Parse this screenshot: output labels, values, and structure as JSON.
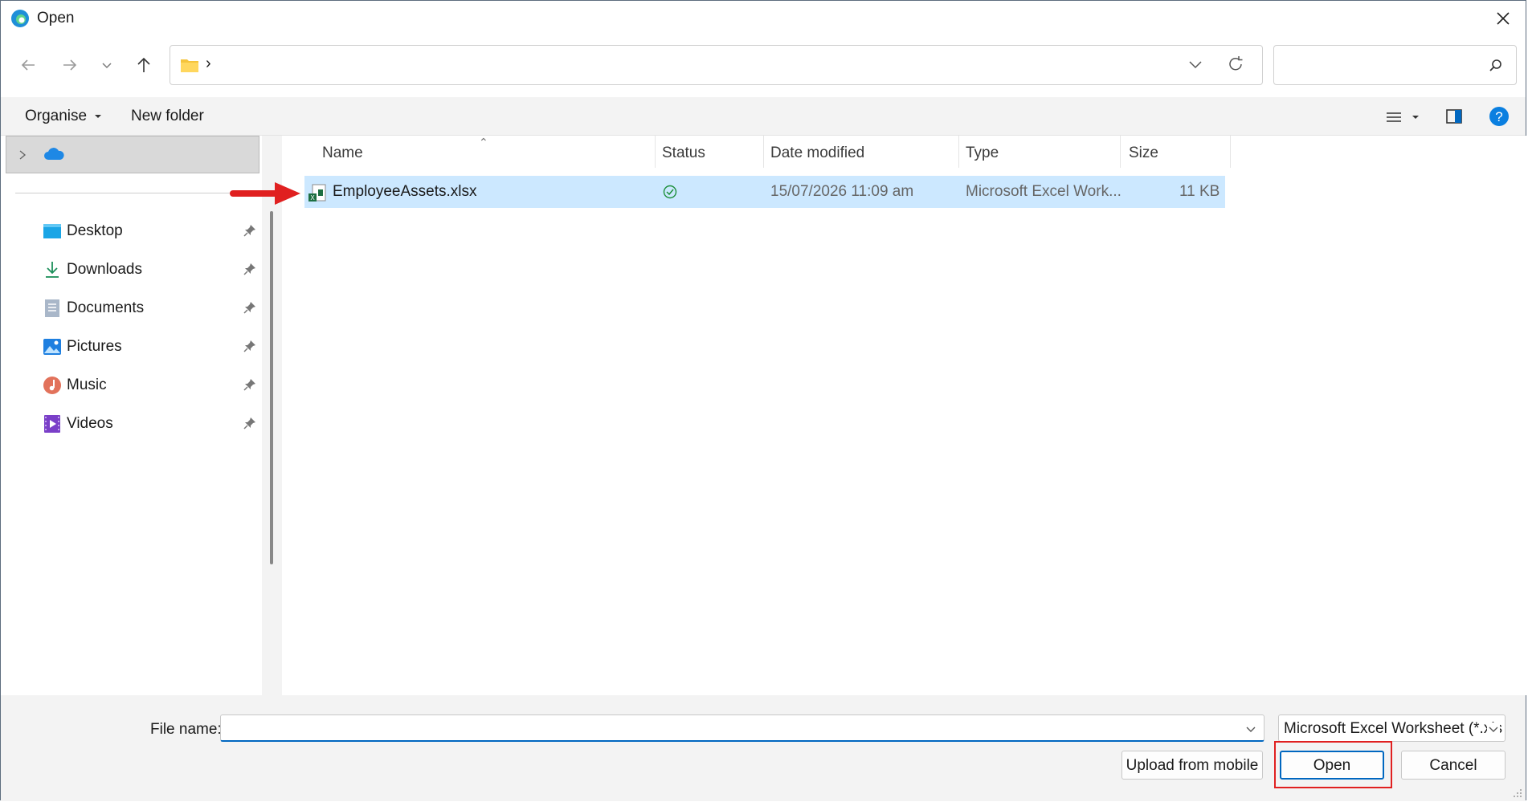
{
  "window": {
    "title": "Open"
  },
  "nav": {
    "address_separator": "›"
  },
  "toolbar": {
    "organise_label": "Organise",
    "new_folder_label": "New folder"
  },
  "sidebar": {
    "items": [
      {
        "label": "Desktop",
        "icon": "desktop-icon"
      },
      {
        "label": "Downloads",
        "icon": "downloads-icon"
      },
      {
        "label": "Documents",
        "icon": "documents-icon"
      },
      {
        "label": "Pictures",
        "icon": "pictures-icon"
      },
      {
        "label": "Music",
        "icon": "music-icon"
      },
      {
        "label": "Videos",
        "icon": "videos-icon"
      }
    ]
  },
  "filelist": {
    "columns": [
      "Name",
      "Status",
      "Date modified",
      "Type",
      "Size"
    ],
    "rows": [
      {
        "name": "EmployeeAssets.xlsx",
        "status_icon": "synced-check-icon",
        "date_modified": "15/07/2026 11:09 am",
        "type": "Microsoft Excel Work...",
        "size": "11 KB"
      }
    ]
  },
  "bottom": {
    "file_name_label": "File name:",
    "file_name_value": "",
    "file_type": "Microsoft Excel Worksheet (*.xls",
    "upload_label": "Upload from mobile",
    "open_label": "Open",
    "cancel_label": "Cancel"
  },
  "colors": {
    "accent": "#0067c0",
    "selection": "#cce8ff",
    "annotation": "#e02020",
    "help": "#0a7fe0"
  }
}
